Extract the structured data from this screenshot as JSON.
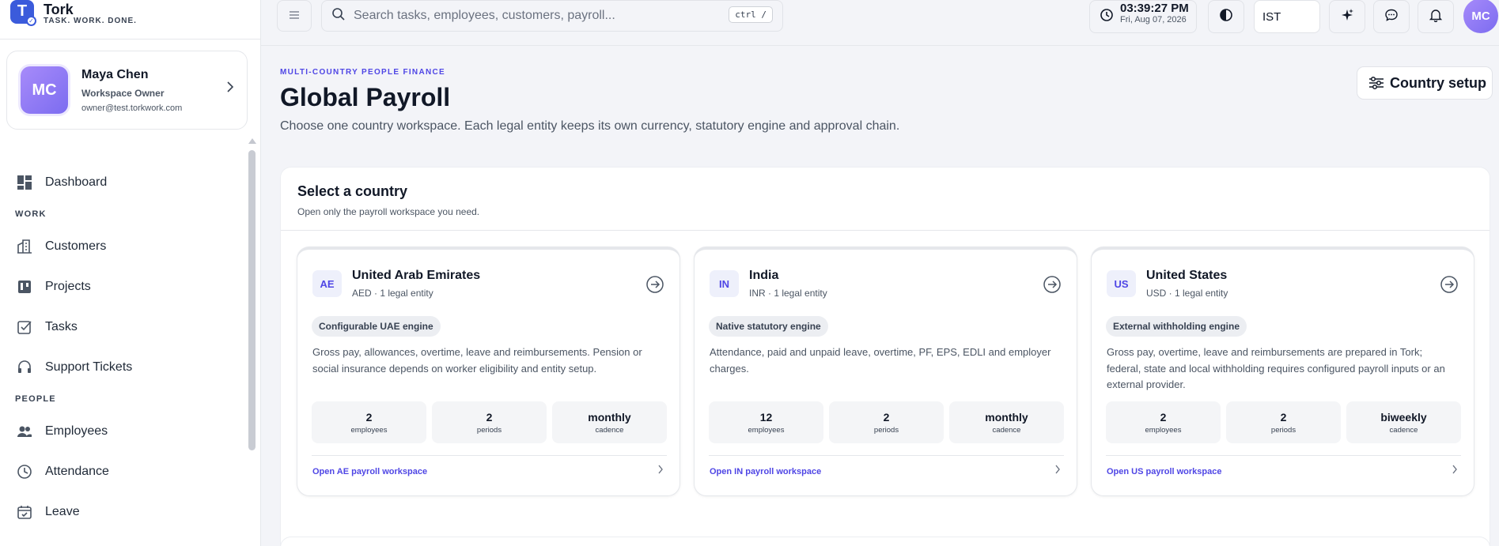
{
  "brand": {
    "name": "Tork",
    "tagline": "TASK. WORK. DONE.",
    "logo_letter": "T"
  },
  "profile": {
    "initials": "MC",
    "name": "Maya Chen",
    "role": "Workspace Owner",
    "email": "owner@test.torkwork.com"
  },
  "nav": {
    "dashboard": "Dashboard",
    "section_work": "WORK",
    "customers": "Customers",
    "projects": "Projects",
    "tasks": "Tasks",
    "support_tickets": "Support Tickets",
    "section_people": "PEOPLE",
    "employees": "Employees",
    "attendance": "Attendance",
    "leave": "Leave"
  },
  "topbar": {
    "search_placeholder": "Search tasks, employees, customers, payroll...",
    "search_shortcut": "ctrl /",
    "clock_time": "03:39:27 PM",
    "clock_date": "Fri, Aug 07, 2026",
    "timezone": "IST",
    "avatar_initials": "MC"
  },
  "header": {
    "eyebrow": "MULTI-COUNTRY PEOPLE FINANCE",
    "title": "Global Payroll",
    "description": "Choose one country workspace. Each legal entity keeps its own currency, statutory engine and approval chain.",
    "setup_button": "Country setup"
  },
  "panel": {
    "title": "Select a country",
    "subtitle": "Open only the payroll workspace you need."
  },
  "countries": [
    {
      "code": "AE",
      "name": "United Arab Emirates",
      "meta": "AED · 1 legal entity",
      "engine": "Configurable UAE engine",
      "description": "Gross pay, allowances, overtime, leave and reimbursements. Pension or social insurance depends on worker eligibility and entity setup.",
      "employees": "2",
      "employees_label": "employees",
      "periods": "2",
      "periods_label": "periods",
      "cadence": "monthly",
      "cadence_label": "cadence",
      "link": "Open AE payroll workspace"
    },
    {
      "code": "IN",
      "name": "India",
      "meta": "INR · 1 legal entity",
      "engine": "Native statutory engine",
      "description": "Attendance, paid and unpaid leave, overtime, PF, EPS, EDLI and employer charges.",
      "employees": "12",
      "employees_label": "employees",
      "periods": "2",
      "periods_label": "periods",
      "cadence": "monthly",
      "cadence_label": "cadence",
      "link": "Open IN payroll workspace"
    },
    {
      "code": "US",
      "name": "United States",
      "meta": "USD · 1 legal entity",
      "engine": "External withholding engine",
      "description": "Gross pay, overtime, leave and reimbursements are prepared in Tork; federal, state and local withholding requires configured payroll inputs or an external provider.",
      "employees": "2",
      "employees_label": "employees",
      "periods": "2",
      "periods_label": "periods",
      "cadence": "biweekly",
      "cadence_label": "cadence",
      "link": "Open US payroll workspace"
    }
  ],
  "colors": {
    "accent": "#4f46e5",
    "brand": "#3b5bdb",
    "avatar": "#8b7cf6"
  }
}
